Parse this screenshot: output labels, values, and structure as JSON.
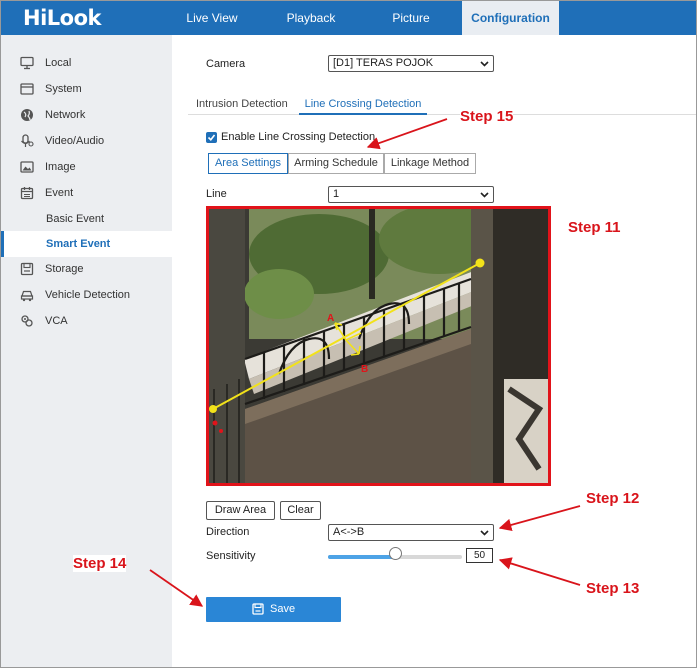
{
  "app": {
    "logo": "HiLook"
  },
  "nav": [
    {
      "label": "Live View",
      "active": false
    },
    {
      "label": "Playback",
      "active": false
    },
    {
      "label": "Picture",
      "active": false
    },
    {
      "label": "Configuration",
      "active": true
    }
  ],
  "sidebar": {
    "items": [
      {
        "label": "Local",
        "icon": "monitor-icon"
      },
      {
        "label": "System",
        "icon": "system-icon"
      },
      {
        "label": "Network",
        "icon": "globe-icon"
      },
      {
        "label": "Video/Audio",
        "icon": "microphone-icon"
      },
      {
        "label": "Image",
        "icon": "image-icon"
      },
      {
        "label": "Event",
        "icon": "calendar-icon"
      },
      {
        "label": "Basic Event",
        "icon": ""
      },
      {
        "label": "Smart Event",
        "icon": "",
        "selected": true
      },
      {
        "label": "Storage",
        "icon": "storage-icon"
      },
      {
        "label": "Vehicle Detection",
        "icon": "vehicle-icon"
      },
      {
        "label": "VCA",
        "icon": "vca-icon"
      }
    ]
  },
  "camera": {
    "label": "Camera",
    "value": "[D1] TERAS POJOK"
  },
  "tabs": [
    {
      "label": "Intrusion Detection",
      "active": false
    },
    {
      "label": "Line Crossing Detection",
      "active": true
    }
  ],
  "enable": {
    "label": "Enable Line Crossing Detection",
    "checked": true
  },
  "subtabs": [
    {
      "label": "Area Settings",
      "active": true
    },
    {
      "label": "Arming Schedule",
      "active": false
    },
    {
      "label": "Linkage Method",
      "active": false
    }
  ],
  "line": {
    "label": "Line",
    "value": "1"
  },
  "video": {
    "point_a": "A",
    "point_b": "B"
  },
  "buttons": {
    "draw_area": "Draw Area",
    "clear": "Clear",
    "save": "Save"
  },
  "direction": {
    "label": "Direction",
    "value": "A<->B"
  },
  "sensitivity": {
    "label": "Sensitivity",
    "value": "50",
    "level_percent": 50
  },
  "annotations": {
    "step11": "Step 11",
    "step12": "Step 12",
    "step13": "Step 13",
    "step14": "Step 14",
    "step15": "Step 15"
  },
  "colors": {
    "brand": "#1f6fb8",
    "accent": "#2a86d6",
    "annotation": "#d9141b",
    "line": "#f2e21a"
  }
}
